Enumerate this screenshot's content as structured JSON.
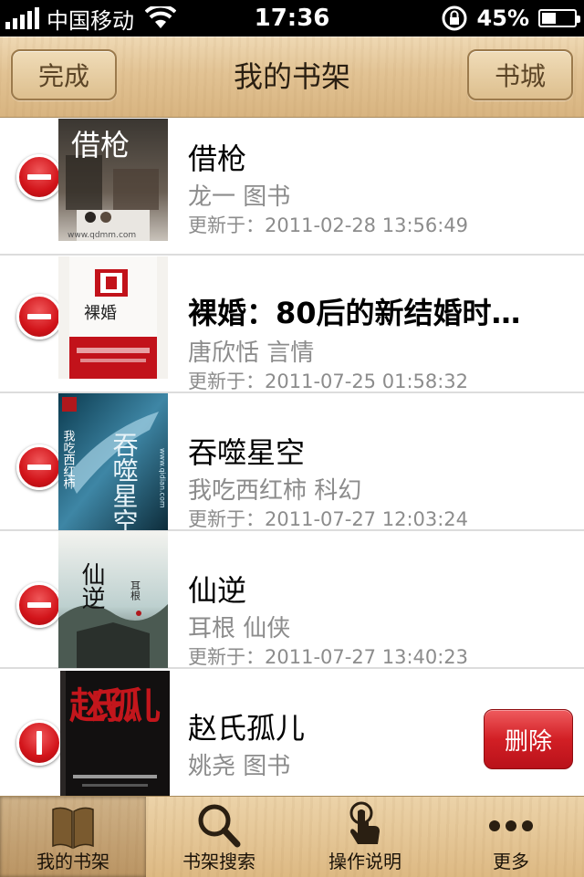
{
  "status_bar": {
    "carrier": "中国移动",
    "time": "17:36",
    "battery": "45%",
    "battery_level": 0.45
  },
  "nav": {
    "title": "我的书架",
    "left_button": "完成",
    "right_button": "书城"
  },
  "books": [
    {
      "title": "借枪",
      "meta": "龙一 图书",
      "updated": "更新于：2011-02-28 13:56:49"
    },
    {
      "title": "裸婚：80后的新结婚时…",
      "meta": "唐欣恬 言情",
      "updated": "更新于：2011-07-25 01:58:32"
    },
    {
      "title": "吞噬星空",
      "meta": "我吃西红柿 科幻",
      "updated": "更新于：2011-07-27 12:03:24"
    },
    {
      "title": "仙逆",
      "meta": "耳根 仙侠",
      "updated": "更新于：2011-07-27 13:40:23"
    },
    {
      "title": "赵氏孤儿",
      "meta": "姚尧 图书",
      "updated": ""
    }
  ],
  "covers": [
    {
      "text": "借枪",
      "url": "www.qdmm.com"
    },
    {
      "text": "裸婚"
    },
    {
      "text": "吞噬星空",
      "author": "我吃西红柿",
      "url": "www.qidian.com"
    },
    {
      "text": "仙逆",
      "author": "耳根"
    },
    {
      "text": "赵氏孤儿"
    }
  ],
  "delete_label": "删除",
  "tabs": [
    {
      "label": "我的书架",
      "icon": "book-icon",
      "active": true
    },
    {
      "label": "书架搜索",
      "icon": "search-icon",
      "active": false
    },
    {
      "label": "操作说明",
      "icon": "hand-pointer-icon",
      "active": false
    },
    {
      "label": "更多",
      "icon": "more-icon",
      "active": false
    }
  ]
}
